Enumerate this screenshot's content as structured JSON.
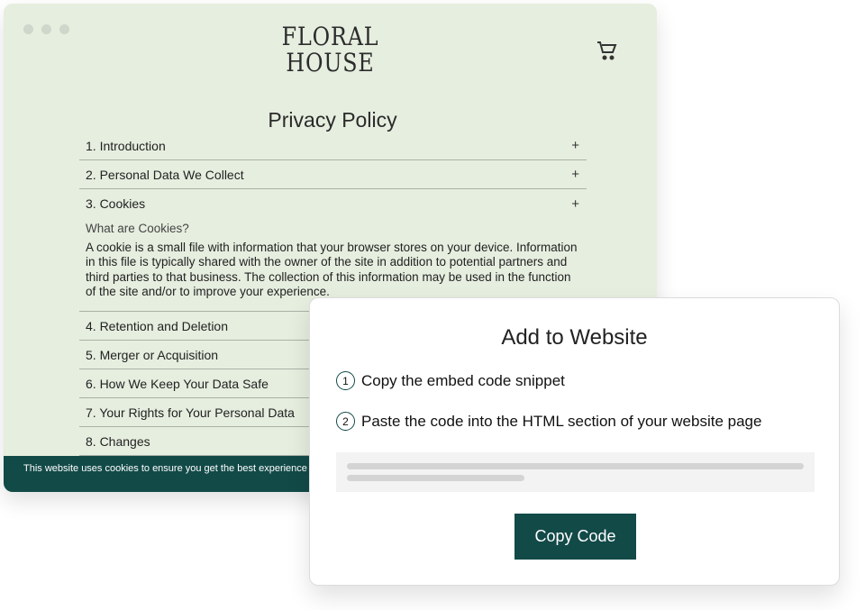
{
  "site": {
    "logo_line1": "FLORAL",
    "logo_line2": "HOUSE",
    "title": "Privacy Policy",
    "sections": [
      {
        "label": "1. Introduction"
      },
      {
        "label": "2. Personal Data We Collect"
      },
      {
        "label": "3. Cookies",
        "open": true,
        "subheading": "What are Cookies?",
        "body": "A cookie is a small file with information that your browser stores on your device. Information in this file is typically shared with the owner of the site in addition to potential partners and third parties to that business. The collection of this information may be used in the function of the site and/or to improve your experience."
      },
      {
        "label": "4. Retention and Deletion"
      },
      {
        "label": "5. Merger or Acquisition"
      },
      {
        "label": "6. How We Keep Your Data Safe"
      },
      {
        "label": "7. Your Rights for Your Personal Data"
      },
      {
        "label": "8. Changes"
      }
    ],
    "expand_symbol": "+",
    "cookie_banner": "This website uses cookies to ensure you get the best experience"
  },
  "modal": {
    "title": "Add to Website",
    "steps": [
      {
        "num": "1",
        "text": "Copy the embed code snippet"
      },
      {
        "num": "2",
        "text": "Paste the code into the HTML section of your website page"
      }
    ],
    "button": "Copy Code"
  },
  "colors": {
    "accent": "#124a48",
    "site_bg": "#e6eedf"
  },
  "icons": {
    "cart": "cart-icon"
  }
}
